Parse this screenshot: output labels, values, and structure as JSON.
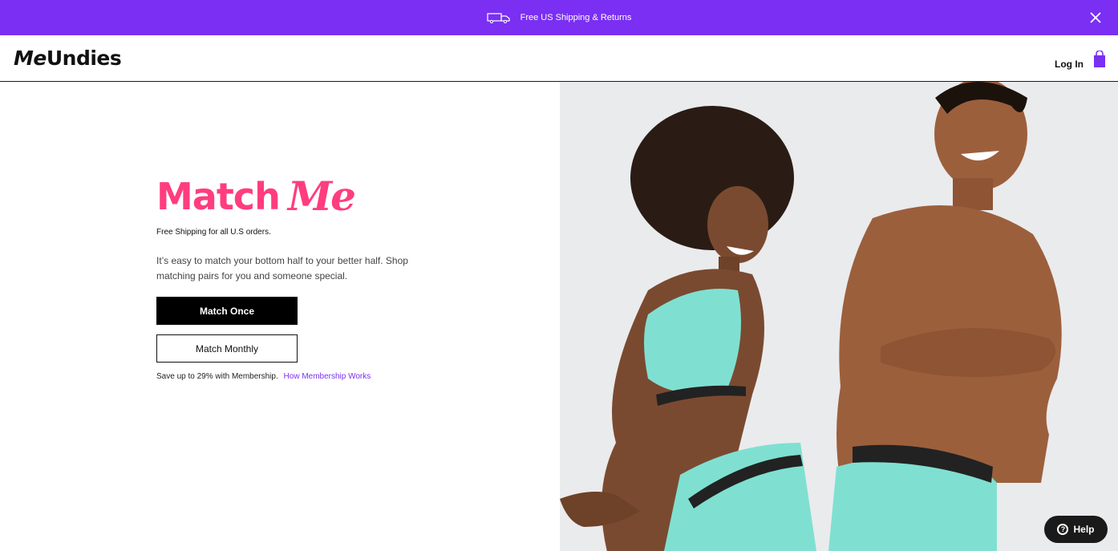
{
  "promo": {
    "text": "Free US Shipping & Returns",
    "icon": "truck-icon",
    "close_icon": "close-icon",
    "color": "#7a2ff2"
  },
  "header": {
    "logo": {
      "me": "Me",
      "undies": "Undies"
    },
    "login": "Log In",
    "bag_icon": "shopping-bag-icon"
  },
  "hero": {
    "headline": {
      "match": "Match",
      "me": "Me",
      "color": "#ff3d7f"
    },
    "shipping_note": "Free Shipping for all U.S orders.",
    "description": "It’s easy to match your bottom half to your better half. Shop matching pairs for you and someone special.",
    "primary_button": "Match Once",
    "secondary_button": "Match Monthly",
    "membership_text": "Save up to 29% with Membership.",
    "membership_link": "How Membership Works"
  },
  "help": {
    "label": "Help",
    "icon": "question-icon"
  },
  "colors": {
    "accent": "#7a2ff2",
    "brand_pink": "#ff3d7f",
    "photo_bg": "#eaebed",
    "underwear": "#7fe0d1"
  }
}
